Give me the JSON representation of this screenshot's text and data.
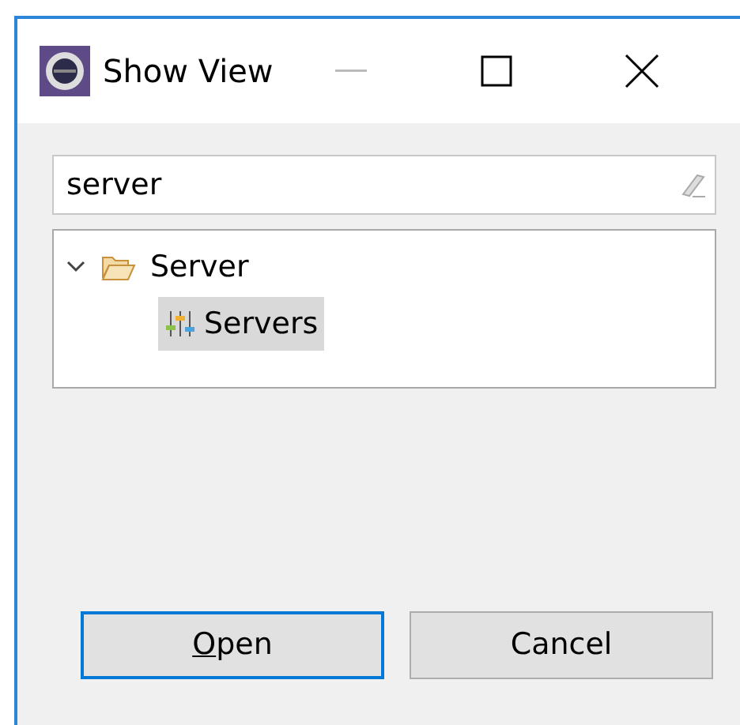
{
  "window": {
    "title": "Show View"
  },
  "search": {
    "value": "server"
  },
  "tree": [
    {
      "label": "Server",
      "expanded": true,
      "selected": false,
      "children": [
        {
          "label": "Servers",
          "selected": true
        }
      ]
    }
  ],
  "buttons": [
    {
      "label": "Open",
      "mnemonic_first_letter": true,
      "default": true
    },
    {
      "label": "Cancel",
      "default": false
    }
  ]
}
